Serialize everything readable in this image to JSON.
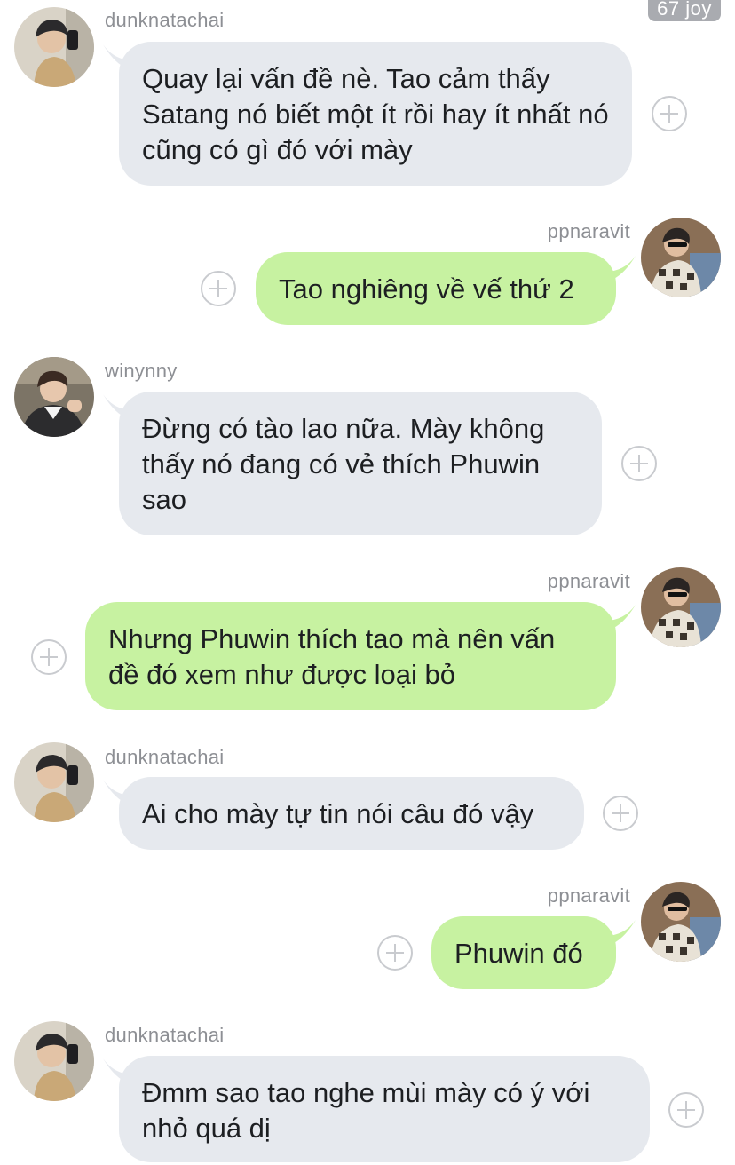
{
  "badge": "67 joy",
  "messages": [
    {
      "sender": "dunknatachai",
      "direction": "in",
      "text": "Quay lại vấn đề nè. Tao cảm thấy Satang nó biết một ít rồi hay ít nhất nó cũng có gì đó với mày"
    },
    {
      "sender": "ppnaravit",
      "direction": "out",
      "text": "Tao nghiêng về vế thứ 2"
    },
    {
      "sender": "winynny",
      "direction": "in",
      "text": "Đừng có tào lao nữa. Mày không thấy nó đang có vẻ thích Phuwin sao"
    },
    {
      "sender": "ppnaravit",
      "direction": "out",
      "text": "Nhưng Phuwin thích tao mà  nên vấn đề đó xem như được loại bỏ"
    },
    {
      "sender": "dunknatachai",
      "direction": "in",
      "text": "Ai cho mày tự tin nói câu đó vậy"
    },
    {
      "sender": "ppnaravit",
      "direction": "out",
      "text": "Phuwin đó"
    },
    {
      "sender": "dunknatachai",
      "direction": "in",
      "text": "Đmm sao tao nghe mùi mày có ý với nhỏ quá dị"
    }
  ],
  "icons": {
    "add_reaction": "plus-circle-icon",
    "avatar": "profile-photo"
  },
  "colors": {
    "incoming_bubble": "#e6e9ee",
    "outgoing_bubble": "#c7f2a1",
    "username": "#8d8f94",
    "add_button": "#c9cbcf"
  }
}
